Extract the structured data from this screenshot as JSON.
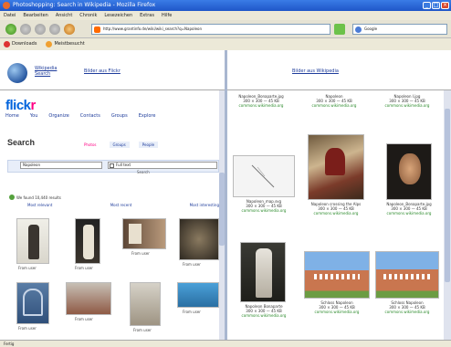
{
  "window": {
    "title": "Photoshopping: Search in Wikipedia - Mozilla Firefox"
  },
  "menu": [
    "Datei",
    "Bearbeiten",
    "Ansicht",
    "Chronik",
    "Lesezeichen",
    "Extras",
    "Hilfe"
  ],
  "nav": {
    "url": "http://www.grantinfo.de/wiki/wiki_search?q=Napoleon",
    "search_placeholder": "Google"
  },
  "bookmarks": [
    "Downloads",
    "Meistbesucht"
  ],
  "top": {
    "globe_label": "Wikipedia Search",
    "left_link": "Bilder aus Flickr",
    "right_link": "Bilder aus Wikipedia"
  },
  "flickr": {
    "logo_a": "flick",
    "logo_b": "r",
    "nav": [
      "Home",
      "You",
      "Organize",
      "Contacts",
      "Groups",
      "Explore"
    ],
    "search_title": "Search",
    "tabs": [
      {
        "label": "Photos"
      },
      {
        "label": "Groups"
      },
      {
        "label": "People"
      }
    ],
    "query": "Napoleon",
    "select": "Full text",
    "search_btn": "Search",
    "results_text": "We found 10,440 results",
    "results_links": [
      "Most relevant",
      "Most recent",
      "Most interesting"
    ],
    "captions": [
      "From user",
      "From user",
      "From user",
      "From user",
      "From user",
      "From user",
      "From user",
      "From user"
    ]
  },
  "wiki": {
    "top_captions": [
      "Napoleon_Bonaparte.jpg",
      "Napoleon",
      "Napoleon I.jpg"
    ],
    "mid_captions": [
      "Napoleon_map.svg",
      "Napoleon crossing the Alps",
      "Napoleon_Bonaparte.jpg"
    ],
    "bottom_captions": [
      "Napoleon Bonaparte",
      "Schloss Napoleon",
      "Schloss Napoleon"
    ],
    "dim_text": "300 × 300 — 45 KB",
    "link_text": "commons.wikimedia.org"
  },
  "status": "Fertig"
}
